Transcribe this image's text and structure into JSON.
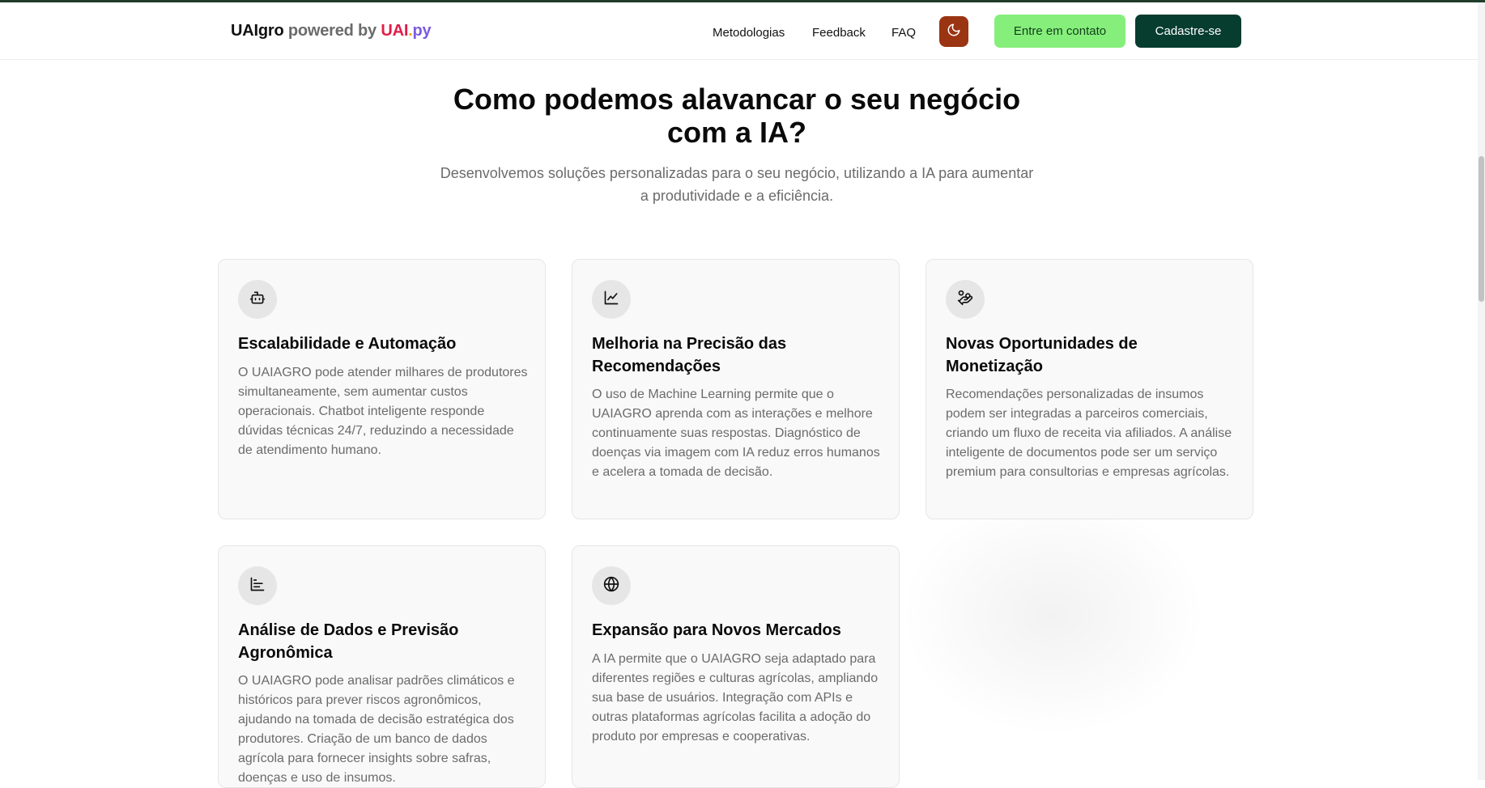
{
  "header": {
    "brand": {
      "part1": "UAIgro",
      "part2": " powered by ",
      "part3": "UAI",
      "part4": ".",
      "part5": "py"
    },
    "nav": [
      "Metodologias",
      "Feedback",
      "FAQ"
    ],
    "theme_toggle_icon": "moon-icon",
    "contact_button": "Entre em contato",
    "signup_button": "Cadastre-se"
  },
  "colors": {
    "contact_button_bg": "#86ef7c",
    "signup_button_bg": "#073d2f",
    "theme_button_bg": "#9a3412",
    "brand_uai": "#e11d48",
    "brand_dot": "#eab308",
    "brand_py": "#7c5ce0"
  },
  "hero": {
    "title": "Como podemos alavancar o seu negócio com a IA?",
    "subtitle": "Desenvolvemos soluções personalizadas para o seu negócio, utilizando a IA para aumentar a produtividade e a eficiência."
  },
  "cards": [
    {
      "icon": "bot-icon",
      "title": "Escalabilidade e Automação",
      "description": "O UAIAGRO pode atender milhares de produtores simultaneamente, sem aumentar custos operacionais. Chatbot inteligente responde dúvidas técnicas 24/7, reduzindo a necessidade de atendimento humano."
    },
    {
      "icon": "line-chart-icon",
      "title": "Melhoria na Precisão das Recomendações",
      "description": "O uso de Machine Learning permite que o UAIAGRO aprenda com as interações e melhore continuamente suas respostas. Diagnóstico de doenças via imagem com IA reduz erros humanos e acelera a tomada de decisão."
    },
    {
      "icon": "hand-coins-icon",
      "title": "Novas Oportunidades de Monetização",
      "description": "Recomendações personalizadas de insumos podem ser integradas a parceiros comerciais, criando um fluxo de receita via afiliados. A análise inteligente de documentos pode ser um serviço premium para consultorias e empresas agrícolas."
    },
    {
      "icon": "bar-chart-icon",
      "title": "Análise de Dados e Previsão Agronômica",
      "description": "O UAIAGRO pode analisar padrões climáticos e históricos para prever riscos agronômicos, ajudando na tomada de decisão estratégica dos produtores. Criação de um banco de dados agrícola para fornecer insights sobre safras, doenças e uso de insumos."
    },
    {
      "icon": "globe-icon",
      "title": "Expansão para Novos Mercados",
      "description": "A IA permite que o UAIAGRO seja adaptado para diferentes regiões e culturas agrícolas, ampliando sua base de usuários. Integração com APIs e outras plataformas agrícolas facilita a adoção do produto por empresas e cooperativas."
    }
  ]
}
